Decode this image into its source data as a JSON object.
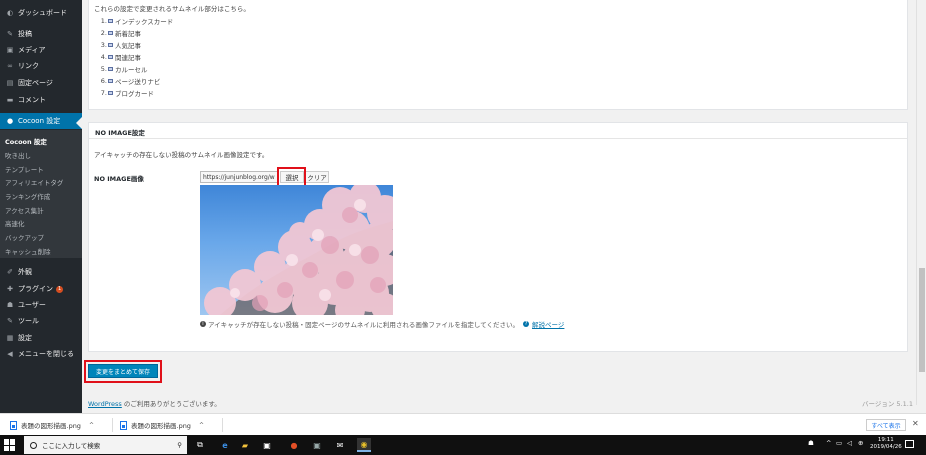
{
  "sidebar": {
    "items": [
      {
        "label": "ダッシュボード",
        "icon": "dashboard-icon",
        "glyph": "◐"
      },
      {
        "label": "投稿",
        "icon": "pin-icon",
        "glyph": "✎"
      },
      {
        "label": "メディア",
        "icon": "media-icon",
        "glyph": "▣"
      },
      {
        "label": "リンク",
        "icon": "link-icon",
        "glyph": "∞"
      },
      {
        "label": "固定ページ",
        "icon": "page-icon",
        "glyph": "▤"
      },
      {
        "label": "コメント",
        "icon": "comment-icon",
        "glyph": "▬"
      },
      {
        "label": "Cocoon 設定",
        "icon": "cocoon-icon",
        "glyph": "●"
      },
      {
        "label": "外観",
        "icon": "appearance-icon",
        "glyph": "✐"
      },
      {
        "label": "プラグイン",
        "icon": "plugin-icon",
        "glyph": "✚",
        "badge": "1"
      },
      {
        "label": "ユーザー",
        "icon": "user-icon",
        "glyph": "☗"
      },
      {
        "label": "ツール",
        "icon": "tool-icon",
        "glyph": "✎"
      },
      {
        "label": "設定",
        "icon": "settings-icon",
        "glyph": "▦"
      },
      {
        "label": "メニューを閉じる",
        "icon": "collapse-icon",
        "glyph": "◀"
      }
    ],
    "submenu": [
      "Cocoon 設定",
      "吹き出し",
      "テンプレート",
      "アフィリエイトタグ",
      "ランキング作成",
      "アクセス集計",
      "高速化",
      "バックアップ",
      "キャッシュ削除"
    ]
  },
  "top_panel": {
    "intro": "これらの設定で変更されるサムネイル部分はこちら。",
    "list": [
      "インデックスカード",
      "新着記事",
      "人気記事",
      "関連記事",
      "カルーセル",
      "ページ送りナビ",
      "ブログカード"
    ]
  },
  "noimage_panel": {
    "title": "NO IMAGE設定",
    "description": "アイキャッチの存在しない投稿のサムネイル画像設定です。",
    "field_label": "NO IMAGE画像",
    "url_value": "https://junjunblog.org/w",
    "select_label": "選択",
    "clear_label": "クリア",
    "note": "アイキャッチが存在しない投稿・固定ページのサムネイルに利用される画像ファイルを指定してください。",
    "help_link": "解説ページ"
  },
  "save_button": "変更をまとめて保存",
  "footer": {
    "wordpress_link": "WordPress",
    "thanks": " のご利用ありがとうございます。",
    "version": "バージョン 5.1.1"
  },
  "downloads": {
    "items": [
      "表題の図形描画.png",
      "表題の図形描画.png"
    ],
    "show_all": "すべて表示",
    "close": "✕"
  },
  "taskbar": {
    "search_placeholder": "ここに入力して検索",
    "time": "19:11",
    "date": "2019/04/26"
  }
}
